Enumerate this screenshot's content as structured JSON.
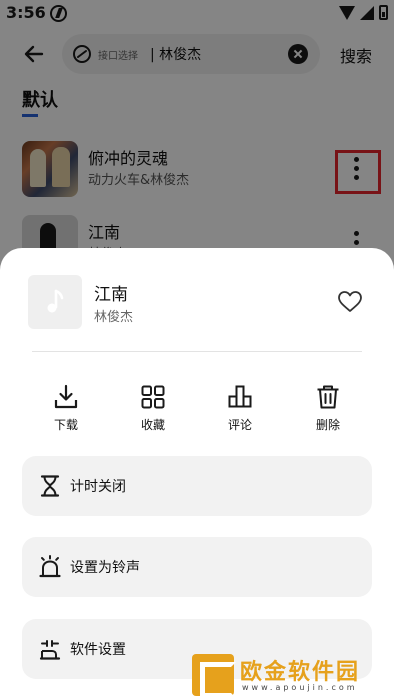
{
  "status_bar": {
    "time": "3:56"
  },
  "header": {
    "search_hint": "接口选择",
    "search_value": "| 林俊杰",
    "search_button": "搜索"
  },
  "tabs": {
    "active": "默认"
  },
  "songs": [
    {
      "title": "俯冲的灵魂",
      "artist": "动力火车&林俊杰"
    },
    {
      "title": "江南",
      "artist": "林俊杰"
    }
  ],
  "sheet": {
    "title": "江南",
    "artist": "林俊杰",
    "actions": [
      {
        "label": "下载",
        "icon": "download-icon"
      },
      {
        "label": "收藏",
        "icon": "grid-icon"
      },
      {
        "label": "评论",
        "icon": "comment-chart-icon"
      },
      {
        "label": "删除",
        "icon": "trash-icon"
      }
    ],
    "menu": [
      {
        "label": "计时关闭",
        "icon": "hourglass-icon"
      },
      {
        "label": "设置为铃声",
        "icon": "alarm-icon"
      },
      {
        "label": "软件设置",
        "icon": "settings-icon"
      }
    ]
  },
  "watermark": {
    "title": "欧金软件园",
    "url": "www.apoujin.com"
  },
  "colors": {
    "accent": "#2a60d6",
    "highlight": "#e6262c",
    "watermark": "#e6a11c"
  }
}
